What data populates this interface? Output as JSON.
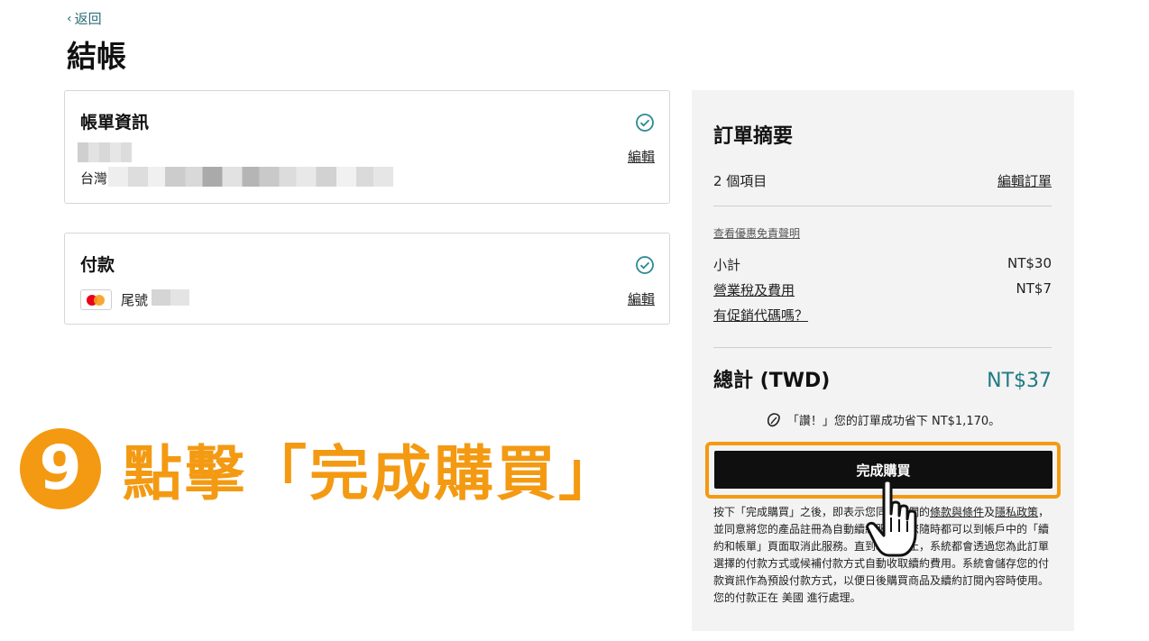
{
  "header": {
    "back_label": "返回",
    "page_title": "結帳"
  },
  "billing": {
    "title": "帳單資訊",
    "country": "台灣",
    "edit_label": "編輯"
  },
  "payment": {
    "title": "付款",
    "card_ending_label": "尾號",
    "edit_label": "編輯"
  },
  "summary": {
    "title": "訂單摘要",
    "items_count": "2 個項目",
    "edit_order_label": "編輯訂單",
    "disclaimer_link": "查看優惠免責聲明",
    "subtotal_label": "小計",
    "subtotal_value": "NT$30",
    "tax_label": "營業稅及費用",
    "tax_value": "NT$7",
    "promo_label": "有促銷代碼嗎？",
    "total_label": "總計 (TWD)",
    "total_value": "NT$37",
    "savings_text": "「讚！」您的訂單成功省下 NT$1,170。",
    "buy_button_label": "完成購買"
  },
  "terms": {
    "p1": "按下「完成購買」之後，即表示您同意我們的",
    "terms_link": "條款與條件",
    "and": "及",
    "privacy_link": "隱私政策",
    "p2": "，並同意將您的產品註冊為自動續約服務，您隨時都可以到帳戶中的「續約和帳單」頁面取消此服務。直到取消為止，系統都會透過您為此訂單選擇的付款方式或候補付款方式自動收取續約費用。系統會儲存您的付款資訊作為預設付款方式，以便日後購買商品及續約訂閱內容時使用。 您的付款正在 美國 進行處理。"
  },
  "annotation": {
    "step_number": "9",
    "text": "點擊「完成購買」"
  },
  "colors": {
    "accent_teal": "#1f7a84",
    "annotation_orange": "#f39a12",
    "button_black": "#0f0f0f"
  }
}
